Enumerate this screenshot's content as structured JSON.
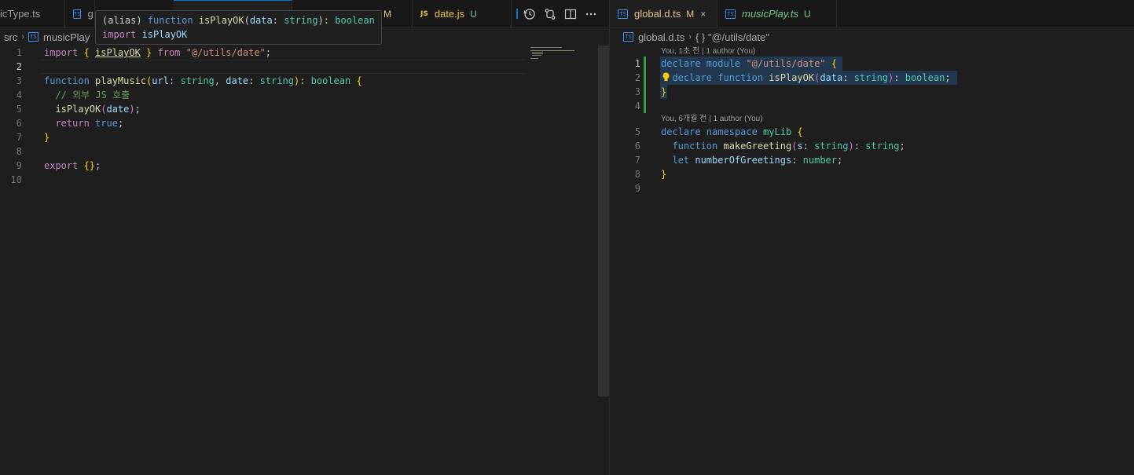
{
  "left_editor": {
    "tabs": [
      {
        "label": "icType.ts",
        "icon": "ts-file-icon"
      },
      {
        "label": "g",
        "icon": "ts-file-icon"
      },
      {
        "label": "",
        "icon": ""
      },
      {
        "label": "M",
        "status_color": "#e2c08d"
      },
      {
        "label": "date.js",
        "icon": "js-file-icon",
        "status": "U"
      }
    ],
    "toolbar": [
      "history-icon",
      "compare-changes-icon",
      "split-editor-icon",
      "more-actions-icon"
    ],
    "breadcrumb": [
      "src",
      "musicPlay"
    ],
    "hover": {
      "line1": [
        {
          "t": "(alias) ",
          "c": "p"
        },
        {
          "t": "function ",
          "c": "kw"
        },
        {
          "t": "isPlayOK",
          "c": "fn"
        },
        {
          "t": "(",
          "c": "p"
        },
        {
          "t": "data",
          "c": "var"
        },
        {
          "t": ": ",
          "c": "p"
        },
        {
          "t": "string",
          "c": "type"
        },
        {
          "t": "): ",
          "c": "p"
        },
        {
          "t": "boolean",
          "c": "type"
        }
      ],
      "line2": [
        {
          "t": "import ",
          "c": "ctrl"
        },
        {
          "t": "isPlayOK",
          "c": "var"
        }
      ]
    },
    "lines": [
      {
        "n": "1",
        "tokens": [
          {
            "t": "import ",
            "c": "ctrl"
          },
          {
            "t": "{ ",
            "c": "br1"
          },
          {
            "t": "isPlayOK",
            "c": "fn u"
          },
          {
            "t": " }",
            "c": "br1"
          },
          {
            "t": " from ",
            "c": "ctrl"
          },
          {
            "t": "\"@/utils/date\"",
            "c": "str"
          },
          {
            "t": ";",
            "c": "p"
          }
        ]
      },
      {
        "n": "2",
        "tokens": []
      },
      {
        "n": "3",
        "tokens": [
          {
            "t": "function ",
            "c": "kw"
          },
          {
            "t": "playMusic",
            "c": "fn"
          },
          {
            "t": "(",
            "c": "br1"
          },
          {
            "t": "url",
            "c": "var"
          },
          {
            "t": ": ",
            "c": "p"
          },
          {
            "t": "string",
            "c": "type"
          },
          {
            "t": ", ",
            "c": "p"
          },
          {
            "t": "date",
            "c": "var"
          },
          {
            "t": ": ",
            "c": "p"
          },
          {
            "t": "string",
            "c": "type"
          },
          {
            "t": ")",
            "c": "br1"
          },
          {
            "t": ": ",
            "c": "p"
          },
          {
            "t": "boolean",
            "c": "type"
          },
          {
            "t": " {",
            "c": "br1"
          }
        ]
      },
      {
        "n": "4",
        "tokens": [
          {
            "t": "  // 외부 JS 호출",
            "c": "cmt"
          }
        ]
      },
      {
        "n": "5",
        "tokens": [
          {
            "t": "  isPlayOK",
            "c": "fn"
          },
          {
            "t": "(",
            "c": "br2"
          },
          {
            "t": "date",
            "c": "var"
          },
          {
            "t": ")",
            "c": "br2"
          },
          {
            "t": ";",
            "c": "p"
          }
        ]
      },
      {
        "n": "6",
        "tokens": [
          {
            "t": "  return ",
            "c": "ctrl"
          },
          {
            "t": "true",
            "c": "kw"
          },
          {
            "t": ";",
            "c": "p"
          }
        ]
      },
      {
        "n": "7",
        "tokens": [
          {
            "t": "}",
            "c": "br1"
          }
        ]
      },
      {
        "n": "8",
        "tokens": []
      },
      {
        "n": "9",
        "tokens": [
          {
            "t": "export ",
            "c": "ctrl"
          },
          {
            "t": "{}",
            "c": "br1"
          },
          {
            "t": ";",
            "c": "p"
          }
        ]
      },
      {
        "n": "10",
        "tokens": []
      }
    ]
  },
  "right_editor": {
    "tabs": [
      {
        "label": "global.d.ts",
        "status": "M",
        "close": "×"
      },
      {
        "label": "musicPlay.ts",
        "status": "U"
      }
    ],
    "breadcrumb": [
      "global.d.ts",
      "{ } \"@/utils/date\""
    ],
    "codelens1": "You, 1초 전 | 1 author (You)",
    "codelens2": "You, 6개월 전 | 1 author (You)",
    "lines": [
      {
        "n": "1",
        "tokens": [
          {
            "t": "declare ",
            "c": "kw"
          },
          {
            "t": "module ",
            "c": "kw"
          },
          {
            "t": "\"@/utils/date\"",
            "c": "str"
          },
          {
            "t": " {",
            "c": "br1"
          }
        ]
      },
      {
        "n": "2",
        "tokens": [
          {
            "t": "  declare ",
            "c": "kw"
          },
          {
            "t": "function ",
            "c": "kw"
          },
          {
            "t": "isPlayOK",
            "c": "fn"
          },
          {
            "t": "(",
            "c": "br2"
          },
          {
            "t": "data",
            "c": "var"
          },
          {
            "t": ": ",
            "c": "p"
          },
          {
            "t": "string",
            "c": "type"
          },
          {
            "t": ")",
            "c": "br2"
          },
          {
            "t": ": ",
            "c": "p"
          },
          {
            "t": "boolean",
            "c": "type"
          },
          {
            "t": ";",
            "c": "p"
          }
        ]
      },
      {
        "n": "3",
        "tokens": [
          {
            "t": "}",
            "c": "br1"
          }
        ]
      },
      {
        "n": "4",
        "tokens": []
      },
      {
        "n": "5",
        "tokens": [
          {
            "t": "declare ",
            "c": "kw"
          },
          {
            "t": "namespace ",
            "c": "kw"
          },
          {
            "t": "myLib ",
            "c": "type"
          },
          {
            "t": "{",
            "c": "br1"
          }
        ]
      },
      {
        "n": "6",
        "tokens": [
          {
            "t": "  function ",
            "c": "kw"
          },
          {
            "t": "makeGreeting",
            "c": "fn"
          },
          {
            "t": "(",
            "c": "br2"
          },
          {
            "t": "s",
            "c": "var"
          },
          {
            "t": ": ",
            "c": "p"
          },
          {
            "t": "string",
            "c": "type"
          },
          {
            "t": ")",
            "c": "br2"
          },
          {
            "t": ": ",
            "c": "p"
          },
          {
            "t": "string",
            "c": "type"
          },
          {
            "t": ";",
            "c": "p"
          }
        ]
      },
      {
        "n": "7",
        "tokens": [
          {
            "t": "  let ",
            "c": "kw"
          },
          {
            "t": "numberOfGreetings",
            "c": "var"
          },
          {
            "t": ": ",
            "c": "p"
          },
          {
            "t": "number",
            "c": "type"
          },
          {
            "t": ";",
            "c": "p"
          }
        ]
      },
      {
        "n": "8",
        "tokens": [
          {
            "t": "}",
            "c": "br1"
          }
        ]
      },
      {
        "n": "9",
        "tokens": []
      }
    ]
  },
  "colors": {
    "modified": "#e2c08d",
    "untracked": "#73c991",
    "active_tab_border": "#0078d4"
  }
}
